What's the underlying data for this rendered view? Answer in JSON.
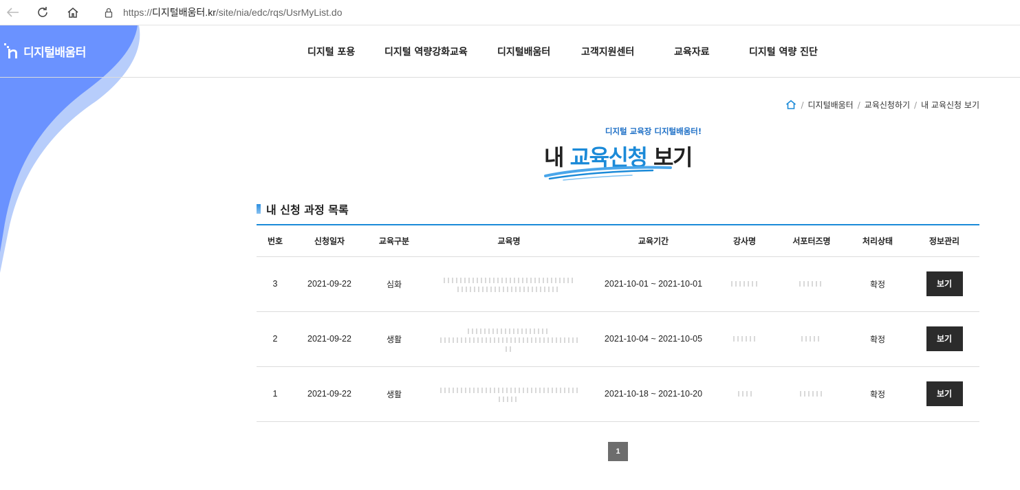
{
  "browser": {
    "url_prefix": "https://",
    "url_domain": "디지털배움터.kr",
    "url_path": "/site/nia/edc/rqs/UsrMyList.do"
  },
  "header": {
    "logo_text": "디지털배움터",
    "nav": [
      "디지털 포용",
      "디지털 역량강화교육",
      "디지털배움터",
      "고객지원센터",
      "교육자료",
      "디지털 역량 진단"
    ]
  },
  "breadcrumb": [
    "디지털배움터",
    "교육신청하기",
    "내 교육신청 보기"
  ],
  "title": {
    "sub": "디지털 교육장 디지털배움터!",
    "main_prefix": "내 ",
    "main_highlight": "교육신청",
    "main_suffix": " 보기"
  },
  "section": {
    "title": "내 신청 과정 목록"
  },
  "table": {
    "headers": [
      "번호",
      "신청일자",
      "교육구분",
      "교육명",
      "교육기간",
      "강사명",
      "서포터즈명",
      "처리상태",
      "정보관리"
    ],
    "rows": [
      {
        "no": "3",
        "date": "2021-09-22",
        "type": "심화",
        "period": "2021-10-01 ~ 2021-10-01",
        "status": "확정",
        "action": "보기"
      },
      {
        "no": "2",
        "date": "2021-09-22",
        "type": "생활",
        "period": "2021-10-04 ~ 2021-10-05",
        "status": "확정",
        "action": "보기"
      },
      {
        "no": "1",
        "date": "2021-09-22",
        "type": "생활",
        "period": "2021-10-18 ~ 2021-10-20",
        "status": "확정",
        "action": "보기"
      }
    ]
  },
  "pagination": {
    "current": "1"
  },
  "colors": {
    "accent": "#1b8ad8",
    "wave": "#5b8cff",
    "button": "#2b2b2b"
  }
}
